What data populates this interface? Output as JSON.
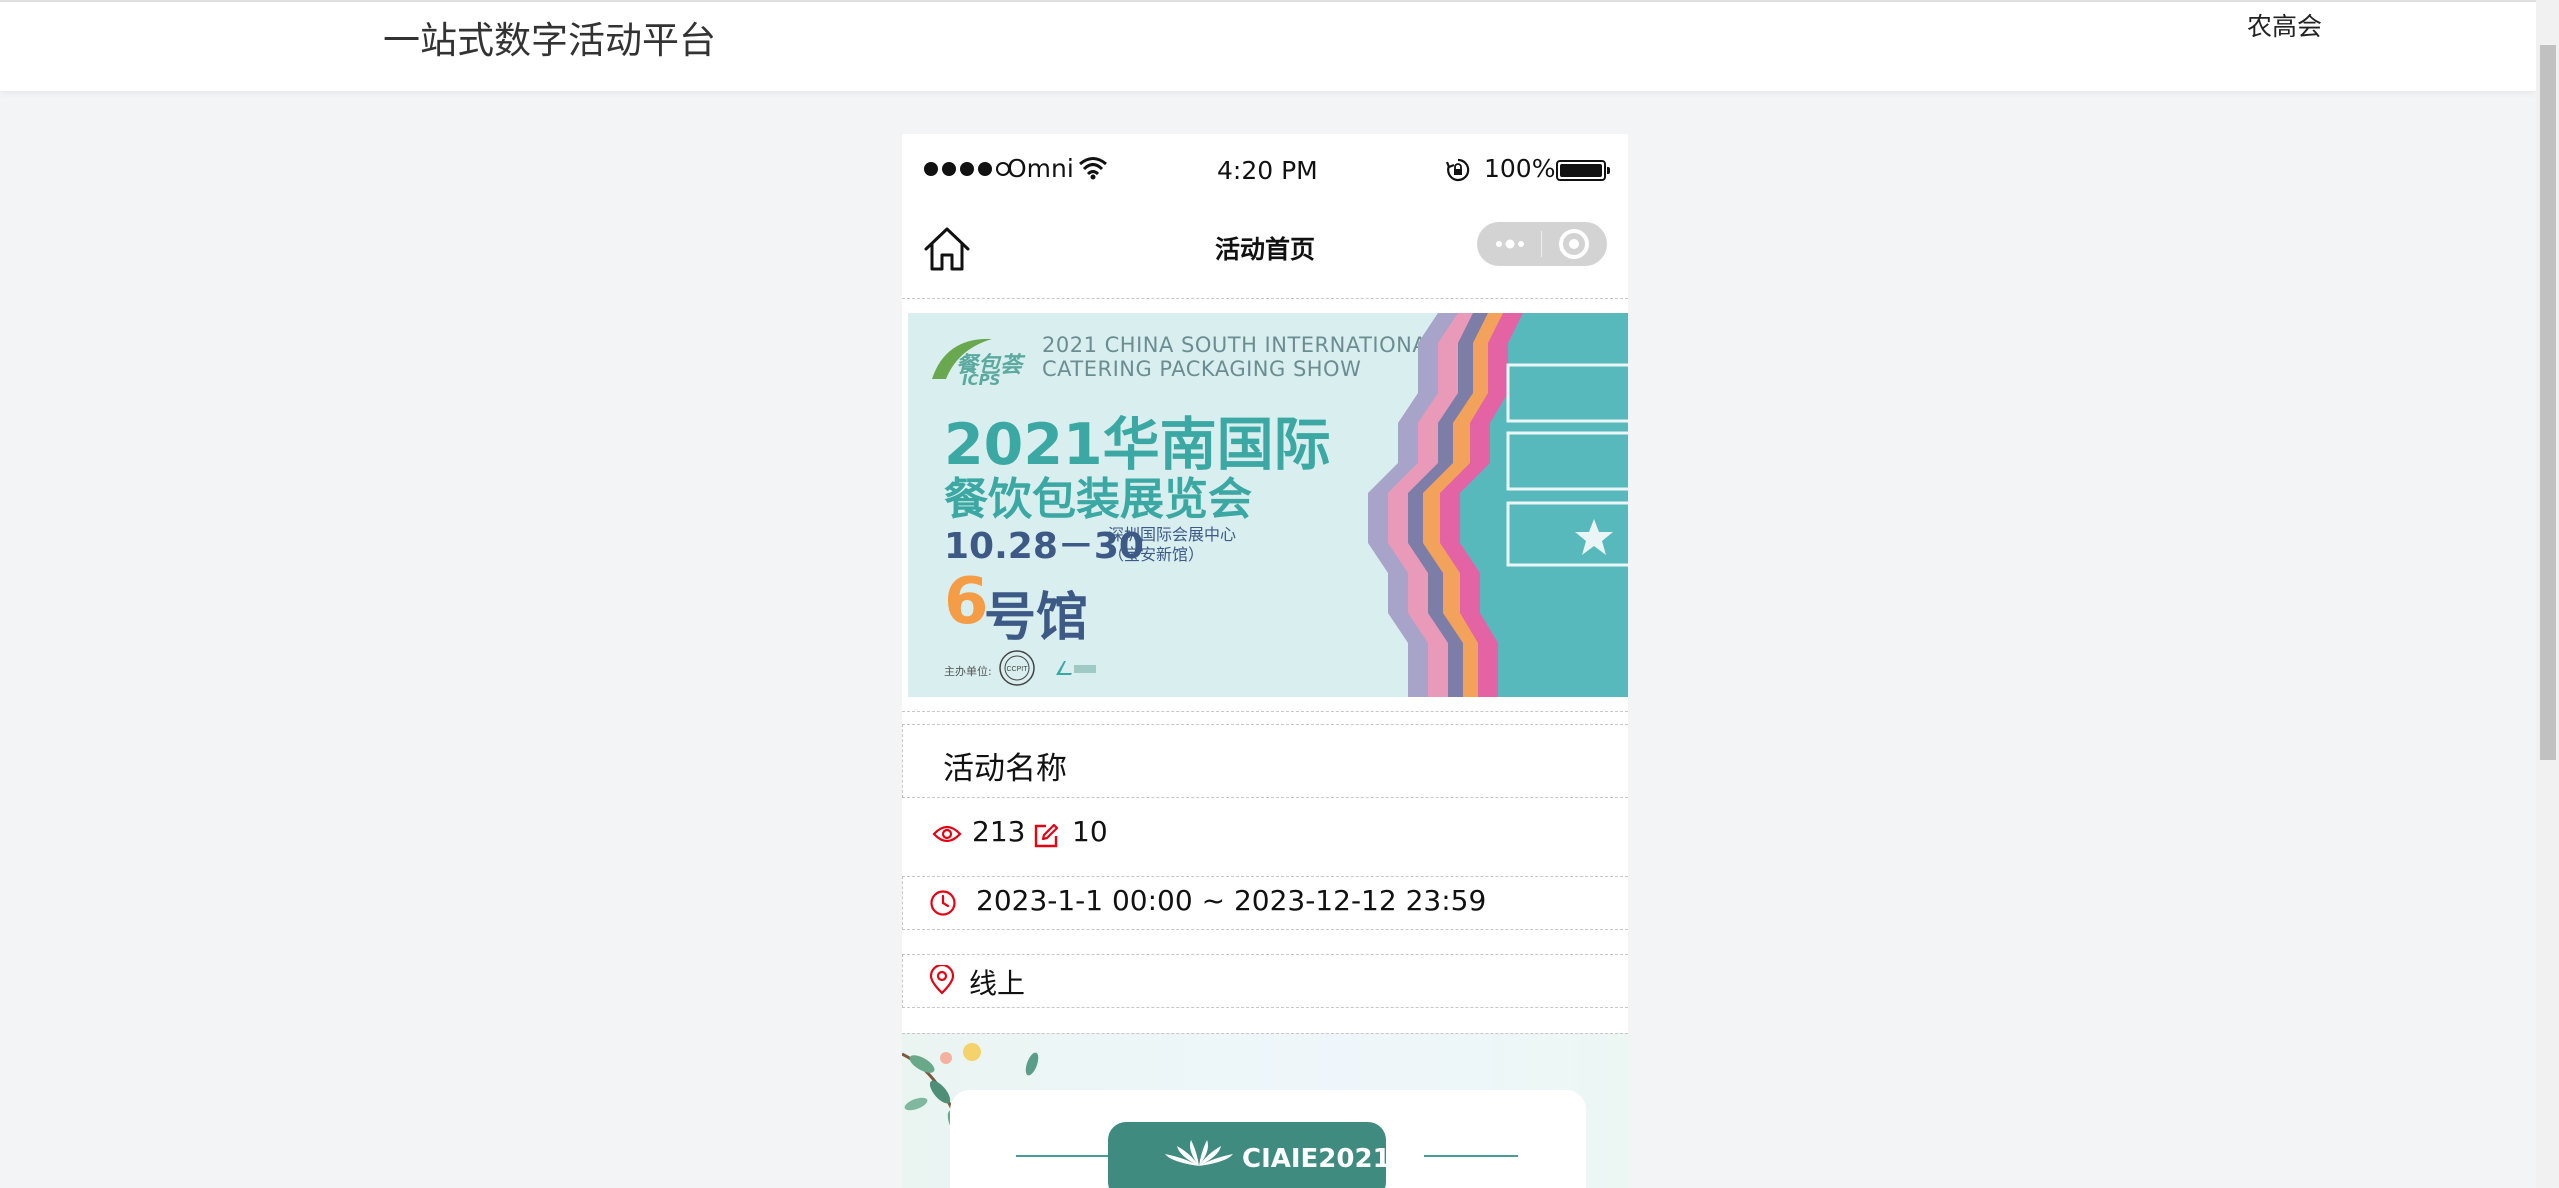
{
  "header": {
    "site_title": "一站式数字活动平台",
    "right_link": "农高会"
  },
  "status_bar": {
    "carrier": "Omni",
    "time": "4:20 PM",
    "battery": "100%"
  },
  "navbar": {
    "title": "活动首页"
  },
  "banner": {
    "logo_text": "餐包荟",
    "logo_sub": "ICPS",
    "title_en_line1": "2021 CHINA SOUTH INTERNATIONAL",
    "title_en_line2": "CATERING PACKAGING SHOW",
    "title_cn_line1": "2021华南国际",
    "title_cn_line2": "餐饮包装展览会",
    "date": "10.28－30",
    "venue_line1": "深圳国际会展中心",
    "venue_line2": "（宝安新馆）",
    "hall_number": "6",
    "hall_label": "号馆",
    "sponsor_label": "主办单位:",
    "sponsor_logo_text": "CCPIT"
  },
  "activity": {
    "name": "活动名称",
    "views": "213",
    "edits": "10",
    "time_range": "2023-1-1 00:00 ~ 2023-12-12 23:59",
    "location": "线上"
  },
  "poster": {
    "title": "CIAIE2021"
  },
  "colors": {
    "accent_red": "#e60012",
    "banner_teal": "#3ca8a3",
    "banner_navy": "#3d5a86",
    "banner_orange": "#f49c46",
    "poster_green": "#3f8b80"
  }
}
